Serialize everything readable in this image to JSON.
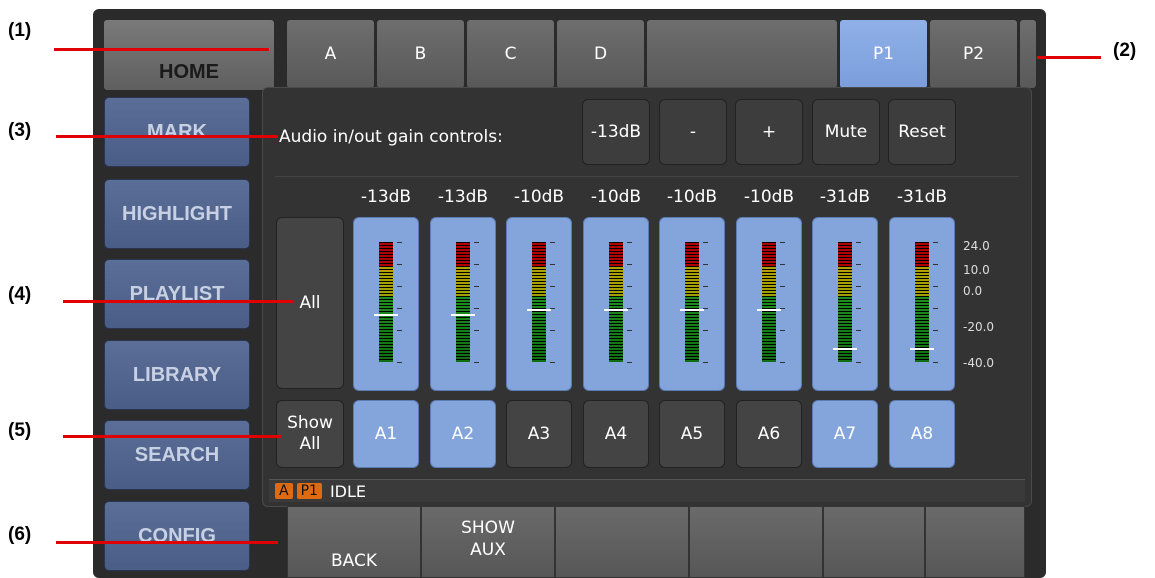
{
  "callouts": [
    "(1)",
    "(2)",
    "(3)",
    "(4)",
    "(5)",
    "(6)"
  ],
  "top_tabs": {
    "home": "HOME",
    "a": "A",
    "b": "B",
    "c": "C",
    "d": "D",
    "p1": "P1",
    "p2": "P2"
  },
  "sidebar": [
    "MARK",
    "HIGHLIGHT",
    "PLAYLIST",
    "LIBRARY",
    "SEARCH",
    "CONFIG"
  ],
  "gain": {
    "label": "Audio in/out gain controls:",
    "value": "-13dB",
    "minus": "-",
    "plus": "+",
    "mute": "Mute",
    "reset": "Reset"
  },
  "all_button": "All",
  "show_all": [
    "Show",
    "All"
  ],
  "channels": [
    {
      "name": "A1",
      "gain": "-13dB",
      "level_pct": 40,
      "active": true
    },
    {
      "name": "A2",
      "gain": "-13dB",
      "level_pct": 40,
      "active": true
    },
    {
      "name": "A3",
      "gain": "-10dB",
      "level_pct": 44,
      "active": false
    },
    {
      "name": "A4",
      "gain": "-10dB",
      "level_pct": 44,
      "active": false
    },
    {
      "name": "A5",
      "gain": "-10dB",
      "level_pct": 44,
      "active": false
    },
    {
      "name": "A6",
      "gain": "-10dB",
      "level_pct": 44,
      "active": false
    },
    {
      "name": "A7",
      "gain": "-31dB",
      "level_pct": 12,
      "active": true
    },
    {
      "name": "A8",
      "gain": "-31dB",
      "level_pct": 12,
      "active": true
    }
  ],
  "scale": [
    "24.0",
    "10.0",
    "0.0",
    "-20.0",
    "-40.0"
  ],
  "status": {
    "badge_a": "A",
    "badge_p1": "P1",
    "text": "IDLE"
  },
  "footer": {
    "back": "BACK",
    "show_aux_1": "SHOW",
    "show_aux_2": "AUX"
  },
  "colors": {
    "accent": "#84a4dc",
    "badge": "#e06a10"
  }
}
